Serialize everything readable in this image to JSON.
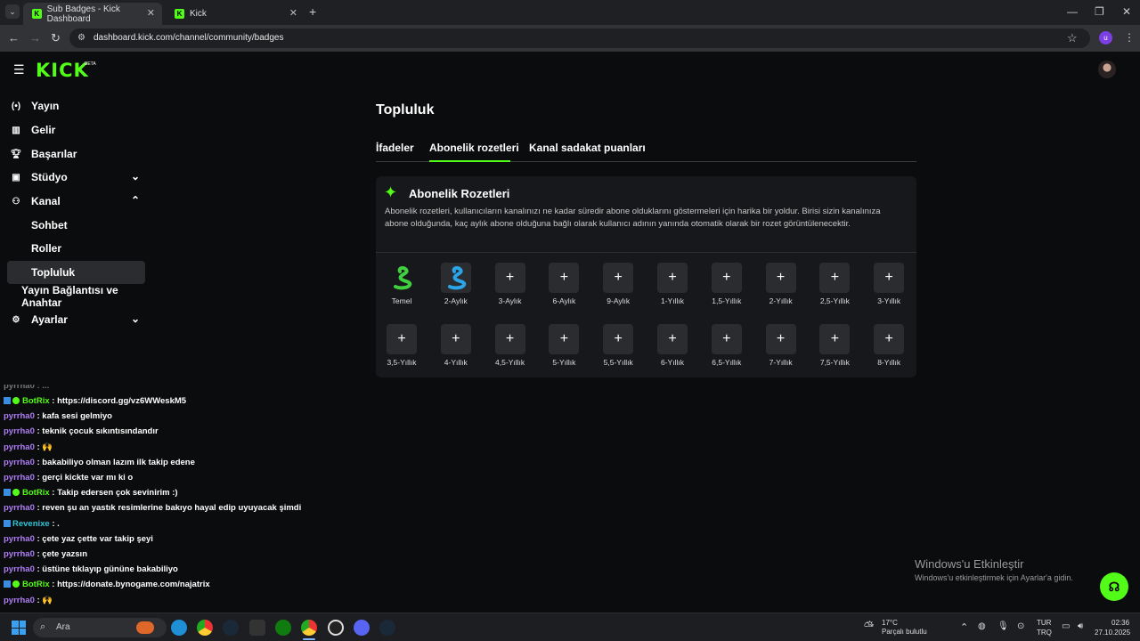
{
  "browser": {
    "tabs": [
      {
        "title": "Sub Badges - Kick Dashboard",
        "active": true
      },
      {
        "title": "Kick",
        "active": false
      }
    ],
    "url": "dashboard.kick.com/channel/community/badges",
    "profile_initial": "u"
  },
  "header": {
    "logo": "KICK",
    "beta": "BETA"
  },
  "sidebar": {
    "items": [
      {
        "label": "Yayın",
        "icon": "broadcast-icon"
      },
      {
        "label": "Gelir",
        "icon": "chart-icon"
      },
      {
        "label": "Başarılar",
        "icon": "trophy-icon"
      },
      {
        "label": "Stüdyo",
        "icon": "studio-icon"
      },
      {
        "label": "Kanal",
        "icon": "channel-icon"
      },
      {
        "label": "Sohbet"
      },
      {
        "label": "Roller"
      },
      {
        "label": "Topluluk"
      },
      {
        "label": "Yayın Bağlantısı ve Anahtar"
      },
      {
        "label": "Ayarlar",
        "icon": "gear-icon"
      }
    ]
  },
  "main": {
    "title": "Topluluk",
    "tabs": [
      "İfadeler",
      "Abonelik rozetleri",
      "Kanal sadakat puanları"
    ],
    "active_tab": "Abonelik rozetleri",
    "card": {
      "title": "Abonelik Rozetleri",
      "description": "Abonelik rozetleri, kullanıcıların kanalınızı ne kadar süredir abone olduklarını göstermeleri için harika bir yoldur. Birisi sizin kanalınıza abone olduğunda, kaç aylık abone olduğuna bağlı olarak kullanıcı adının yanında otomatik olarak bir rozet görüntülenecektir.",
      "badges_row1": [
        "Temel",
        "2-Aylık",
        "3-Aylık",
        "6-Aylık",
        "9-Aylık",
        "1-Yıllık",
        "1,5-Yıllık",
        "2-Yıllık",
        "2,5-Yıllık",
        "3-Yıllık"
      ],
      "badges_row2": [
        "3,5-Yıllık",
        "4-Yıllık",
        "4,5-Yıllık",
        "5-Yıllık",
        "5,5-Yıllık",
        "6-Yıllık",
        "6,5-Yıllık",
        "7-Yıllık",
        "7,5-Yıllık",
        "8-Yıllık"
      ],
      "add_symbol": "+"
    }
  },
  "chat": [
    {
      "user": "BotRix",
      "type": "bot",
      "msg": ": https://discord.gg/vz6WWeskM5"
    },
    {
      "user": "pyrrha0",
      "type": "user",
      "msg": ": kafa sesi gelmiyo"
    },
    {
      "user": "pyrrha0",
      "type": "user",
      "msg": ": teknik çocuk sıkıntısındandır"
    },
    {
      "user": "pyrrha0",
      "type": "user",
      "msg": ": 🙌"
    },
    {
      "user": "pyrrha0",
      "type": "user",
      "msg": ": bakabiliyo olman lazım ilk takip edene"
    },
    {
      "user": "pyrrha0",
      "type": "user",
      "msg": ": gerçi kickte var mı ki o"
    },
    {
      "user": "BotRix",
      "type": "bot",
      "msg": ": Takip edersen çok sevinirim :)"
    },
    {
      "user": "pyrrha0",
      "type": "user",
      "msg": ": reven şu an yastık resimlerine bakıyo hayal edip uyuyacak şimdi"
    },
    {
      "user": "Revenixe",
      "type": "rev",
      "msg": ": ."
    },
    {
      "user": "pyrrha0",
      "type": "user",
      "msg": ": çete yaz çette var takip şeyi"
    },
    {
      "user": "pyrrha0",
      "type": "user",
      "msg": ": çete yazsın"
    },
    {
      "user": "pyrrha0",
      "type": "user",
      "msg": ": üstüne tıklayıp gününe bakabiliyo"
    },
    {
      "user": "BotRix",
      "type": "bot",
      "msg": ": https://donate.bynogame.com/najatrix"
    },
    {
      "user": "pyrrha0",
      "type": "user",
      "msg": ": 🙌"
    }
  ],
  "watermark": {
    "line1": "Windows'u Etkinleştir",
    "line2": "Windows'u etkinleştirmek için Ayarlar'a gidin."
  },
  "taskbar": {
    "search_placeholder": "Ara",
    "weather_temp": "17°C",
    "weather_desc": "Parçalı bulutlu",
    "lang1": "TUR",
    "lang2": "TRQ",
    "time": "02:36",
    "date": "27.10.2025"
  },
  "colors": {
    "accent": "#53fc18",
    "bg": "#0b0c0d",
    "card": "#17181b"
  }
}
